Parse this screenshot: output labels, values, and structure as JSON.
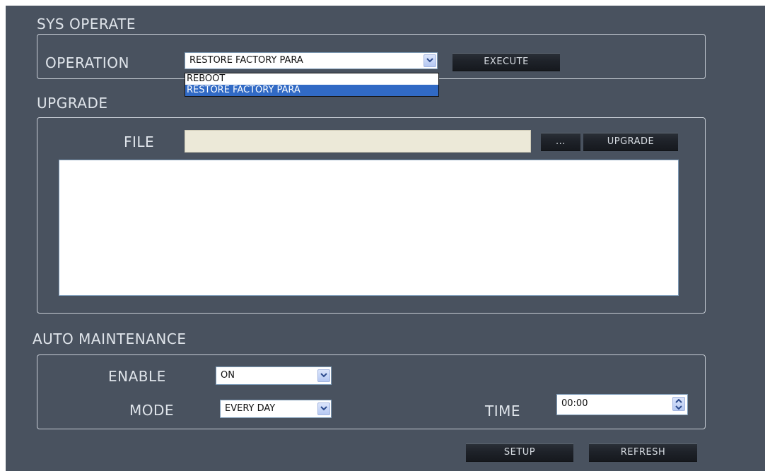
{
  "sys_operate": {
    "title": "SYS OPERATE",
    "operation_label": "OPERATION",
    "operation_value": "RESTORE FACTORY PARA",
    "operation_options": [
      "REBOOT",
      "RESTORE FACTORY PARA"
    ],
    "selected_option_index": 1,
    "execute_label": "EXECUTE"
  },
  "upgrade": {
    "title": "UPGRADE",
    "file_label": "FILE",
    "file_value": "",
    "browse_label": "...",
    "upgrade_label": "UPGRADE"
  },
  "auto_maintenance": {
    "title": "AUTO MAINTENANCE",
    "enable_label": "ENABLE",
    "enable_value": "ON",
    "mode_label": "MODE",
    "mode_value": "EVERY DAY",
    "time_label": "TIME",
    "time_value": "00:00"
  },
  "footer": {
    "setup_label": "SETUP",
    "refresh_label": "REFRESH"
  },
  "colors": {
    "background": "#49525f",
    "label_text": "#dfe4ea",
    "panel_border": "#c8ced6",
    "selection": "#316ac5",
    "file_field": "#ece9d8"
  },
  "icons": {
    "combo_arrow": "chevron-down-icon",
    "spinner": "spinner-arrows-icon"
  }
}
